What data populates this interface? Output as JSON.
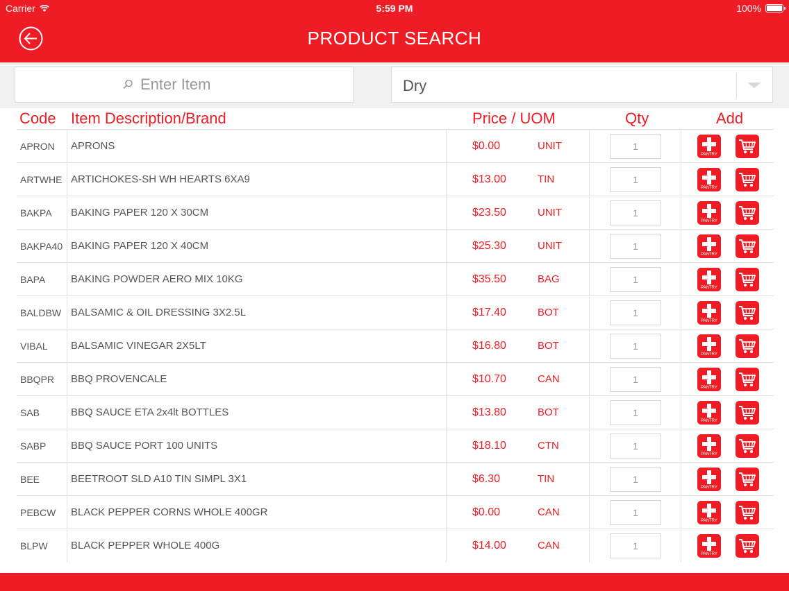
{
  "status": {
    "carrier": "Carrier",
    "time": "5:59 PM",
    "battery": "100%"
  },
  "header": {
    "title": "PRODUCT SEARCH"
  },
  "search": {
    "placeholder": "Enter Item",
    "category": "Dry"
  },
  "columns": {
    "code": "Code",
    "description": "Item Description/Brand",
    "price_uom": "Price / UOM",
    "qty": "Qty",
    "add": "Add"
  },
  "pantry_label": "PANTRY",
  "colors": {
    "accent": "#ee1c25",
    "text": "#555555",
    "border": "#e4e4e4"
  },
  "icons": {
    "back": "back-arrow-icon",
    "search": "search-icon",
    "dropdown": "chevron-down-icon",
    "pantry": "plus-pantry-icon",
    "cart": "shopping-cart-icon"
  },
  "rows": [
    {
      "code": "APRON",
      "desc": "APRONS",
      "price": "$0.00",
      "uom": "UNIT",
      "qty": "1"
    },
    {
      "code": "ARTWHE",
      "desc": "ARTICHOKES-SH WH HEARTS 6XA9",
      "price": "$13.00",
      "uom": "TIN",
      "qty": "1"
    },
    {
      "code": "BAKPA",
      "desc": "BAKING PAPER 120 X 30CM",
      "price": "$23.50",
      "uom": "UNIT",
      "qty": "1"
    },
    {
      "code": "BAKPA40",
      "desc": "BAKING PAPER 120 X 40CM",
      "price": "$25.30",
      "uom": "UNIT",
      "qty": "1"
    },
    {
      "code": "BAPA",
      "desc": "BAKING POWDER AERO MIX 10KG",
      "price": "$35.50",
      "uom": "BAG",
      "qty": "1"
    },
    {
      "code": "BALDBW",
      "desc": "BALSAMIC & OIL DRESSING 3X2.5L",
      "price": "$17.40",
      "uom": "BOT",
      "qty": "1"
    },
    {
      "code": "VIBAL",
      "desc": "BALSAMIC VINEGAR 2X5LT",
      "price": "$16.80",
      "uom": "BOT",
      "qty": "1"
    },
    {
      "code": "BBQPR",
      "desc": "BBQ PROVENCALE",
      "price": "$10.70",
      "uom": "CAN",
      "qty": "1"
    },
    {
      "code": "SAB",
      "desc": "BBQ SAUCE ETA  2x4lt BOTTLES",
      "price": "$13.80",
      "uom": "BOT",
      "qty": "1"
    },
    {
      "code": "SABP",
      "desc": "BBQ SAUCE PORT 100 UNITS",
      "price": "$18.10",
      "uom": "CTN",
      "qty": "1"
    },
    {
      "code": "BEE",
      "desc": "BEETROOT SLD A10 TIN SIMPL 3X1",
      "price": "$6.30",
      "uom": "TIN",
      "qty": "1"
    },
    {
      "code": "PEBCW",
      "desc": "BLACK PEPPER CORNS WHOLE 400GR",
      "price": "$0.00",
      "uom": "CAN",
      "qty": "1"
    },
    {
      "code": "BLPW",
      "desc": "BLACK PEPPER WHOLE 400G",
      "price": "$14.00",
      "uom": "CAN",
      "qty": "1"
    }
  ]
}
